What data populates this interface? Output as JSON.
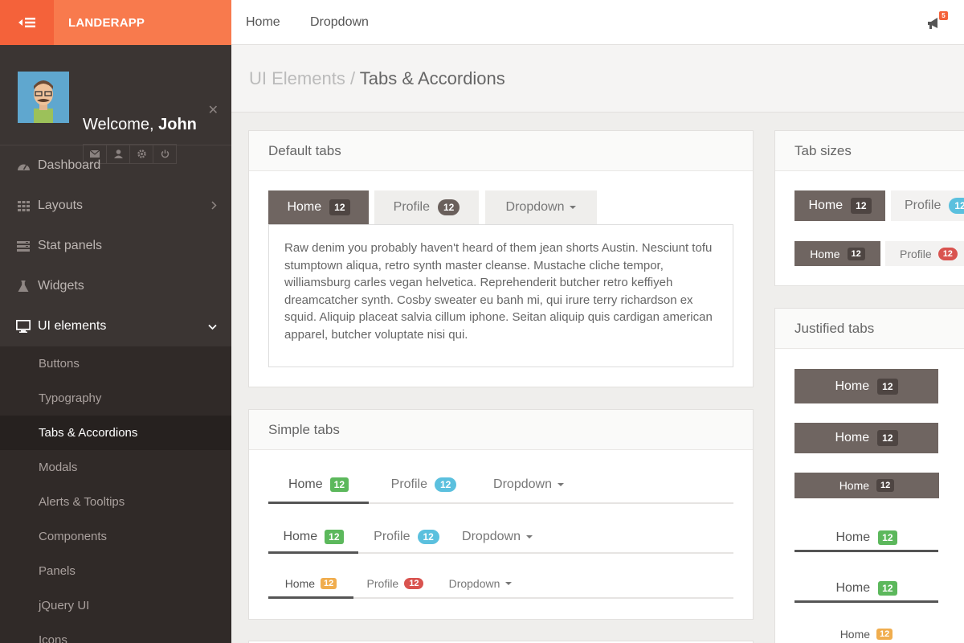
{
  "brand": {
    "name": "LANDERAPP",
    "toggle_icon": "menu-icon"
  },
  "profile": {
    "greeting": "Welcome,",
    "user": "John"
  },
  "nav": {
    "items": [
      {
        "label": "Dashboard",
        "icon": "dashboard-icon"
      },
      {
        "label": "Layouts",
        "icon": "grid-icon"
      },
      {
        "label": "Stat panels",
        "icon": "stat-icon"
      },
      {
        "label": "Widgets",
        "icon": "flask-icon"
      },
      {
        "label": "UI elements",
        "icon": "monitor-icon"
      }
    ],
    "sub_items": [
      "Buttons",
      "Typography",
      "Tabs & Accordions",
      "Modals",
      "Alerts & Tooltips",
      "Components",
      "Panels",
      "jQuery UI",
      "Icons"
    ]
  },
  "topbar": {
    "links": [
      "Home",
      "Dropdown"
    ],
    "notifications": "5"
  },
  "breadcrumb": {
    "parent": "UI Elements",
    "separator": "/",
    "current": "Tabs & Accordions"
  },
  "default_tabs": {
    "title": "Default tabs",
    "tabs": [
      {
        "label": "Home",
        "badge": "12"
      },
      {
        "label": "Profile",
        "badge": "12"
      },
      {
        "label": "Dropdown"
      }
    ],
    "content": "Raw denim you probably haven't heard of them jean shorts Austin. Nesciunt tofu stumptown aliqua, retro synth master cleanse. Mustache cliche tempor, williamsburg carles vegan helvetica. Reprehenderit butcher retro keffiyeh dreamcatcher synth. Cosby sweater eu banh mi, qui irure terry richardson ex squid. Aliquip placeat salvia cillum iphone. Seitan aliquip quis cardigan american apparel, butcher voluptate nisi qui."
  },
  "simple_tabs": {
    "title": "Simple tabs",
    "tabs": [
      {
        "label": "Home",
        "badge": "12"
      },
      {
        "label": "Profile",
        "badge": "12"
      },
      {
        "label": "Dropdown"
      }
    ]
  },
  "tab_sizes": {
    "title": "Tab sizes",
    "tabs": [
      {
        "label": "Home",
        "badge": "12"
      },
      {
        "label": "Profile",
        "badge": "12"
      }
    ]
  },
  "justified_tabs": {
    "title": "Justified tabs",
    "tabs": [
      {
        "label": "Home",
        "badge": "12"
      }
    ]
  },
  "colors": {
    "accent": "#f4623a",
    "accent_light": "#f87a4d",
    "sidebar": "#3b3533",
    "tab_active": "#6f6561"
  }
}
